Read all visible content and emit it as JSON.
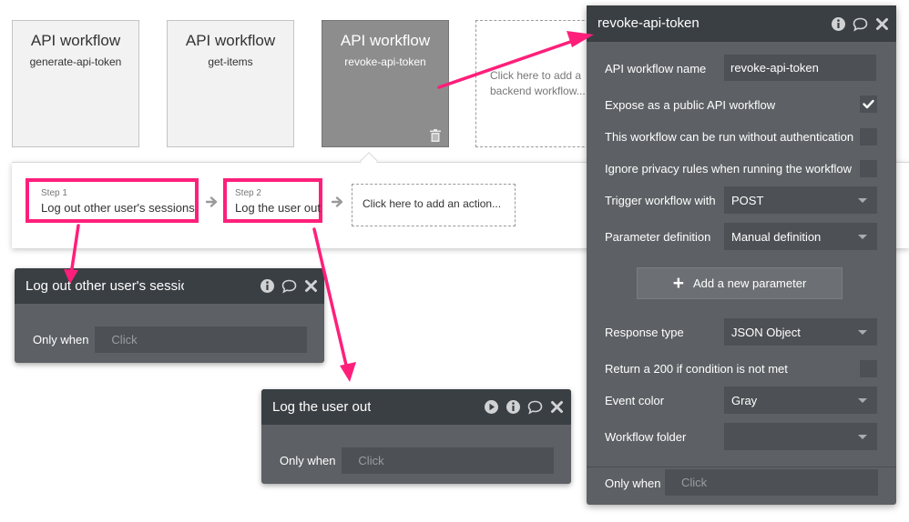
{
  "workflows": [
    {
      "title": "API workflow",
      "name": "generate-api-token"
    },
    {
      "title": "API workflow",
      "name": "get-items"
    },
    {
      "title": "API workflow",
      "name": "revoke-api-token"
    }
  ],
  "add_workflow_hint": {
    "line1": "Click here to add a",
    "line2": "backend workflow..."
  },
  "steps": [
    {
      "num": "Step 1",
      "name": "Log out other user's sessions"
    },
    {
      "num": "Step 2",
      "name": "Log the user out"
    }
  ],
  "add_action_label": "Click here to add an action...",
  "action_popups": [
    {
      "title": "Log out other user's sessions",
      "only_when_label": "Only when",
      "only_when_placeholder": "Click"
    },
    {
      "title": "Log the user out",
      "only_when_label": "Only when",
      "only_when_placeholder": "Click"
    }
  ],
  "editor": {
    "title": "revoke-api-token",
    "name_label": "API workflow name",
    "name_value": "revoke-api-token",
    "expose_label": "Expose as a public API workflow",
    "expose_checked": true,
    "no_auth_label": "This workflow can be run without authentication",
    "no_auth_checked": false,
    "ignore_privacy_label": "Ignore privacy rules when running the workflow",
    "ignore_privacy_checked": false,
    "trigger_label": "Trigger workflow with",
    "trigger_value": "POST",
    "param_def_label": "Parameter definition",
    "param_def_value": "Manual definition",
    "add_param_label": "Add a new parameter",
    "response_label": "Response type",
    "response_value": "JSON Object",
    "return200_label": "Return a 200 if condition is not met",
    "return200_checked": false,
    "color_label": "Event color",
    "color_value": "Gray",
    "folder_label": "Workflow folder",
    "folder_value": "",
    "only_when_label": "Only when",
    "only_when_placeholder": "Click"
  },
  "colors": {
    "highlight": "#ff1f7a",
    "panel": "#5d6064",
    "panel_header": "#3a3f43",
    "field": "#4d5054",
    "selected_card": "#8d8d8d"
  }
}
